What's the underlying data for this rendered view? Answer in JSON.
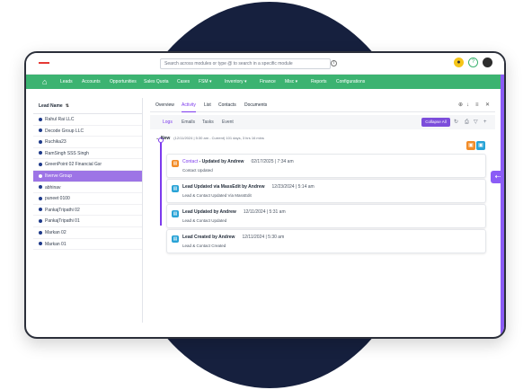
{
  "topbar": {
    "search_placeholder": "Search across modules or type @ to search in a specific module",
    "icons": [
      "notification-icon",
      "help-icon",
      "avatar"
    ]
  },
  "nav": {
    "items": [
      "Leads",
      "Accounts",
      "Opportunities",
      "Sales Quota",
      "Cases",
      "FSM ▾",
      "Inventory ▾",
      "Finance",
      "Misc ▾",
      "Reports",
      "Configurations"
    ]
  },
  "sidebar": {
    "header": "Lead Name",
    "leads": [
      {
        "name": "Rahul Rai LLC",
        "active": false
      },
      {
        "name": "Decode Group LLC",
        "active": false
      },
      {
        "name": "Ruchika23",
        "active": false
      },
      {
        "name": "RamSingh SSS Singh",
        "active": false
      },
      {
        "name": "GreenPoint 02 Financial Gsr",
        "active": false
      },
      {
        "name": "Ilverve Group",
        "active": true
      },
      {
        "name": "abhinav",
        "active": false
      },
      {
        "name": "puneet 0100",
        "active": false
      },
      {
        "name": "PankajTripathi 02",
        "active": false
      },
      {
        "name": "PankajTripathi 01",
        "active": false
      },
      {
        "name": "Markan 02",
        "active": false
      },
      {
        "name": "Markan 01",
        "active": false
      }
    ]
  },
  "detail": {
    "tabs": [
      "Overview",
      "Activity",
      "List",
      "Contacts",
      "Documents"
    ],
    "active_tab": "Activity",
    "subtabs": [
      "Logs",
      "Emails",
      "Tasks",
      "Event"
    ],
    "collapse_label": "Collapse All",
    "group": {
      "label": "New",
      "meta": "(12/11/2024 | 5:30 am - Current) 101 days, 3 hrs 16 mins"
    },
    "activities": [
      {
        "title_link": "Contact",
        "title_rest": " - Updated by Andrew",
        "time": "02/17/2025 | 7:34 am",
        "detail": "Contact Updated",
        "icon_color": "#f28c28"
      },
      {
        "title_link": "",
        "title_rest": "Lead Updated via MassEdit by Andrew",
        "time": "12/23/2024 | 5:14 am",
        "detail": "Lead & Contact Updated Via MassEdit",
        "icon_color": "#29a3d6"
      },
      {
        "title_link": "",
        "title_rest": "Lead Updated by Andrew",
        "time": "12/11/2024 | 5:31 am",
        "detail": "Lead & Contact Updated",
        "icon_color": "#29a3d6"
      },
      {
        "title_link": "",
        "title_rest": "Lead Created by Andrew",
        "time": "12/11/2024 | 5:30 am",
        "detail": "Lead & Contact Created",
        "icon_color": "#29a3d6"
      }
    ]
  },
  "colors": {
    "nav_green": "#3cb371",
    "accent_purple": "#7c3aed",
    "background_navy": "#16203e"
  }
}
